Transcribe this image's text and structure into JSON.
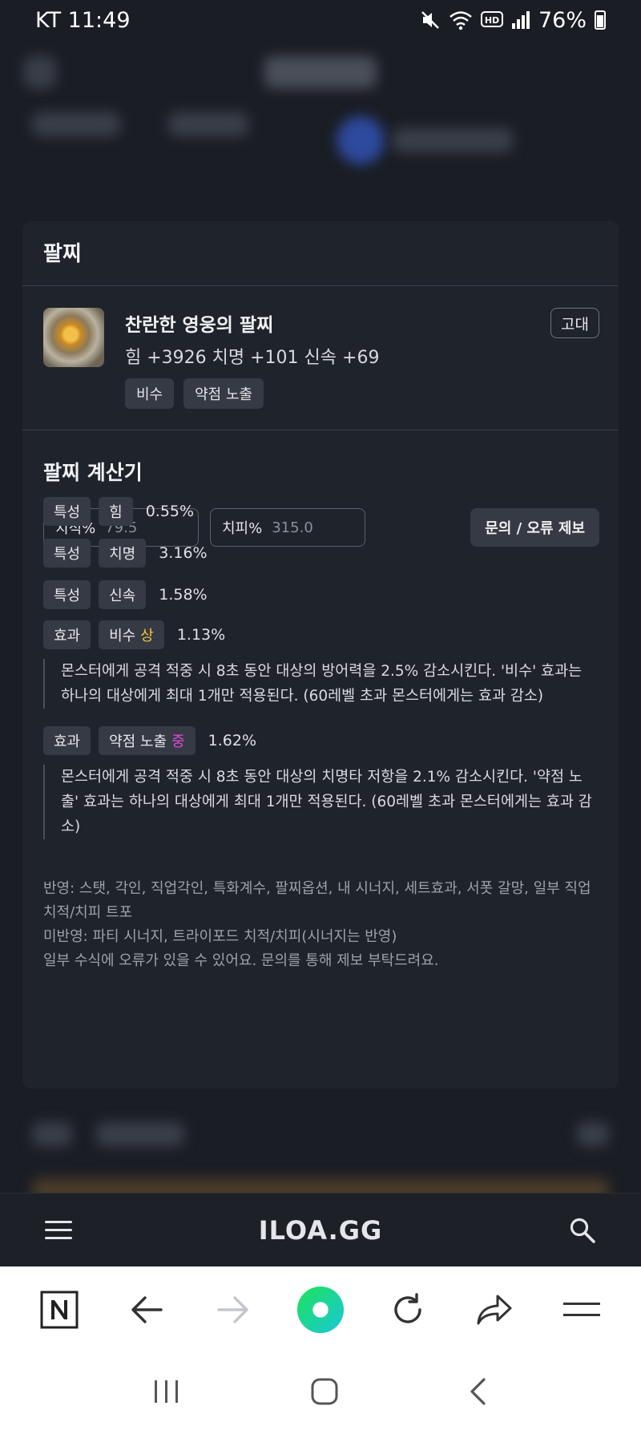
{
  "status_bar": {
    "carrier_time": "KT 11:49",
    "battery": "76%",
    "icons": [
      "mute-icon",
      "wifi-icon",
      "hd-icon",
      "signal-icon",
      "battery-icon"
    ]
  },
  "card": {
    "title": "팔찌",
    "item": {
      "name": "찬란한 영웅의 팔찌",
      "stats": "힘 +3926  치명 +101  신속 +69",
      "grade": "고대",
      "tags": [
        "비수",
        "약점 노출"
      ]
    },
    "calculator": {
      "title": "팔찌 계산기",
      "crit_dmg_label": "치적%",
      "crit_dmg_value": "79.5",
      "crit_pierce_label": "치피%",
      "crit_pierce_value": "315.0",
      "report_button": "문의 / 오류 제보",
      "rows": [
        {
          "type": "특성",
          "name": "힘",
          "value": "0.55%"
        },
        {
          "type": "특성",
          "name": "치명",
          "value": "3.16%"
        },
        {
          "type": "특성",
          "name": "신속",
          "value": "1.58%"
        },
        {
          "type": "효과",
          "name": "비수",
          "grade": "상",
          "value": "1.13%",
          "desc": "몬스터에게 공격 적중 시 8초 동안 대상의 방어력을 2.5% 감소시킨다. '비수' 효과는 하나의 대상에게 최대 1개만 적용된다. (60레벨 초과 몬스터에게는 효과 감소)"
        },
        {
          "type": "효과",
          "name": "약점 노출",
          "grade": "중",
          "value": "1.62%",
          "desc": "몬스터에게 공격 적중 시 8초 동안 대상의 치명타 저항을 2.1% 감소시킨다. '약점 노출' 효과는 하나의 대상에게 최대 1개만 적용된다. (60레벨 초과 몬스터에게는 효과 감소)"
        }
      ],
      "notes": [
        "반영: 스탯, 각인, 직업각인, 특화계수, 팔찌옵션, 내 시너지, 세트효과, 서폿 갈망, 일부 직업 치적/치피 트포",
        "미반영: 파티 시너지, 트라이포드 치적/치피(시너지는 반영)",
        "일부 수식에 오류가 있을 수 있어요. 문의를 통해 제보 부탁드려요."
      ]
    }
  },
  "site_nav": {
    "logo": "ILOA.GG"
  },
  "colors": {
    "background": "#1a1d24",
    "card": "#1f232b",
    "chip": "#353a44",
    "grade_high": "#f5c23a",
    "grade_mid": "#e24bd8",
    "browser_accent": "#1ed9a0"
  }
}
